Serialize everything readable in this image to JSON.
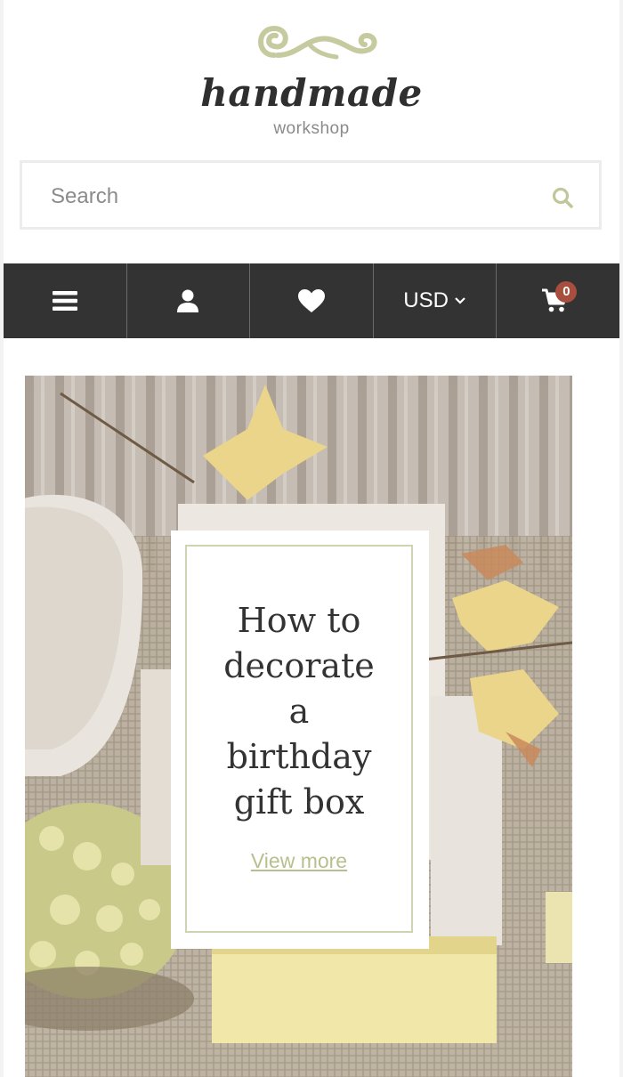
{
  "brand": {
    "name": "handmade",
    "tagline": "workshop",
    "accent_color": "#c5cb9e"
  },
  "search": {
    "placeholder": "Search",
    "icon": "search-icon"
  },
  "toolbar": {
    "items": [
      {
        "icon": "menu-icon"
      },
      {
        "icon": "user-icon"
      },
      {
        "icon": "heart-icon"
      },
      {
        "label": "USD",
        "icon": "chevron-down-icon"
      },
      {
        "icon": "cart-icon",
        "badge": "0"
      }
    ],
    "background": "#333333",
    "badge_color": "#a84e3e"
  },
  "hero": {
    "title_lines": [
      "How to",
      "decorate",
      "a",
      "birthday",
      "gift box"
    ],
    "link_label": "View more",
    "link_color": "#b8bf8e"
  }
}
